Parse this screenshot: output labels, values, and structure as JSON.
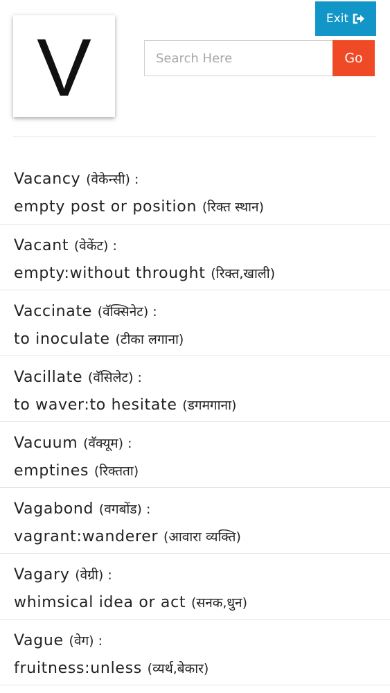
{
  "header": {
    "letter": "V",
    "exit_label": "Exit",
    "exit_icon": "sign-out-icon",
    "search_placeholder": "Search Here",
    "search_value": "",
    "go_label": "Go",
    "colors": {
      "exit": "#1296c8",
      "go": "#ef4a25"
    }
  },
  "words": [
    {
      "word": "Vacancy",
      "word_hi": "(वेकेन्सी) :",
      "meaning": "empty post or position",
      "meaning_hi": "(रिक्त स्थान)"
    },
    {
      "word": "Vacant",
      "word_hi": "(वेकेंट) :",
      "meaning": "empty:without throught",
      "meaning_hi": "(रिक्त,खाली)"
    },
    {
      "word": "Vaccinate",
      "word_hi": "(वॅक्सिनेट) :",
      "meaning": "to inoculate",
      "meaning_hi": "(टीका लगाना)"
    },
    {
      "word": "Vacillate",
      "word_hi": "(वॅसिलेट) :",
      "meaning": "to waver:to hesitate",
      "meaning_hi": "(डगमगाना)"
    },
    {
      "word": "Vacuum",
      "word_hi": "(वॅक्यूम) :",
      "meaning": "emptines",
      "meaning_hi": "(रिक्तता)"
    },
    {
      "word": "Vagabond",
      "word_hi": "(वगबोंड) :",
      "meaning": "vagrant:wanderer",
      "meaning_hi": "(आवारा व्यक्ति)"
    },
    {
      "word": "Vagary",
      "word_hi": "(वेग्री) :",
      "meaning": "whimsical idea or act",
      "meaning_hi": "(सनक,धुन)"
    },
    {
      "word": "Vague",
      "word_hi": "(वेग) :",
      "meaning": "fruitness:unless",
      "meaning_hi": "(व्यर्थ,बेकार)"
    }
  ]
}
